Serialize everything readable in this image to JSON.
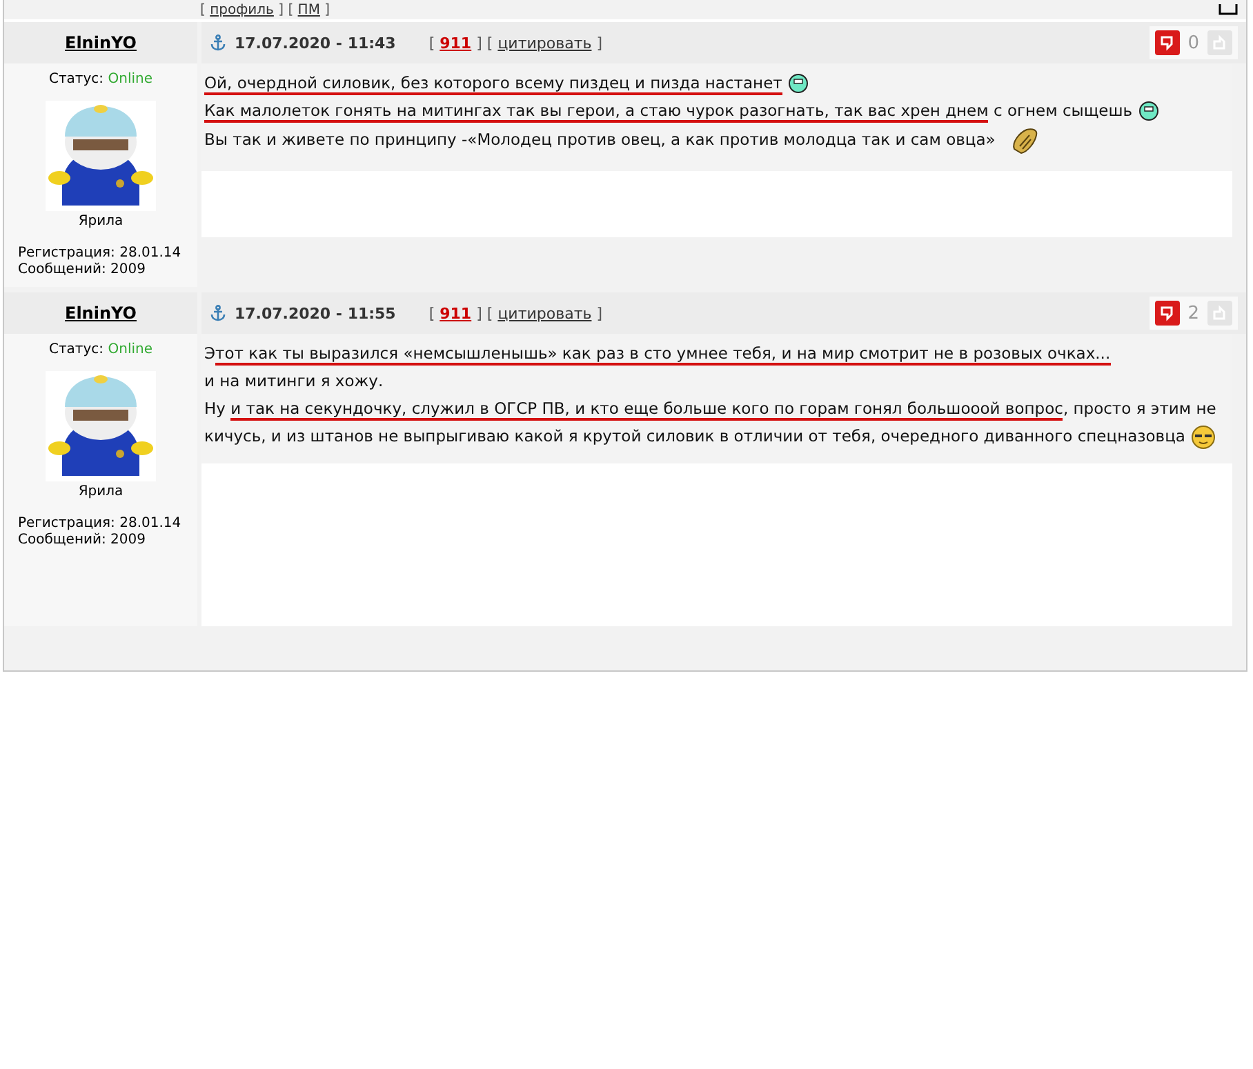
{
  "top_links": {
    "open": "[",
    "items": [
      {
        "label": "профиль"
      },
      {
        "label": "ПМ"
      }
    ],
    "separator": "] [",
    "close": "]"
  },
  "posts": [
    {
      "author": "ElninYO",
      "status_label": "Статус:",
      "status": "Online",
      "rank": "Ярила",
      "registration": "Регистрация: 28.01.14",
      "messages": "Сообщений: 2009",
      "date": "17.07.2020 - 11:43",
      "open": "[",
      "post_number": "911",
      "separator": "] [",
      "close": "]",
      "quote_link": "цитировать",
      "rating": "0",
      "paragraphs": [
        {
          "segments": [
            {
              "text": "Ой, очердной силовик, без которого всему пиздец и пизда настанет",
              "underlined": true
            }
          ],
          "emoticon": {
            "kind": "roll"
          }
        },
        {
          "segments": [
            {
              "text": "Как малолеток гонять на митингах так вы герои, а стаю чурок разогнать, так вас хрен днем",
              "underlined": true
            },
            {
              "text": " с огнем сыщешь",
              "underlined": false
            }
          ],
          "emoticon": {
            "kind": "roll"
          }
        },
        {
          "segments": [
            {
              "text": "Вы так и живете по принципу -«Молодец против овец, а как против молодца так и сам овца»",
              "underlined": false
            }
          ],
          "emoticon": {
            "kind": "clap"
          }
        }
      ]
    },
    {
      "author": "ElninYO",
      "status_label": "Статус:",
      "status": "Online",
      "rank": "Ярила",
      "registration": "Регистрация: 28.01.14",
      "messages": "Сообщений: 2009",
      "date": "17.07.2020 - 11:55",
      "open": "[",
      "post_number": "911",
      "separator": "] [",
      "close": "]",
      "quote_link": "цитировать",
      "rating": "2",
      "paragraphs": [
        {
          "segments": [
            {
              "text": "Э",
              "underlined": false
            },
            {
              "text": "тот как ты выразился «немсышленышь» как раз в сто умнее тебя, и на мир смотрит не в розовых очках...",
              "underlined": true
            }
          ]
        },
        {
          "segments": [
            {
              "text": "и на митинги я хожу.",
              "underlined": false
            }
          ]
        },
        {
          "segments": [
            {
              "text": "Ну ",
              "underlined": false
            },
            {
              "text": "и так на секундочку, служил в ОГСР ПВ, и кто еще больше кого по горам гонял большооой вопрос",
              "underlined": true
            },
            {
              "text": ", просто я этим не кичусь, и из штанов не выпрыгиваю какой я крутой силовик в отличии от тебя, очередного диванного спецназовца",
              "underlined": false
            }
          ],
          "emoticon": {
            "kind": "cool"
          }
        }
      ]
    }
  ]
}
